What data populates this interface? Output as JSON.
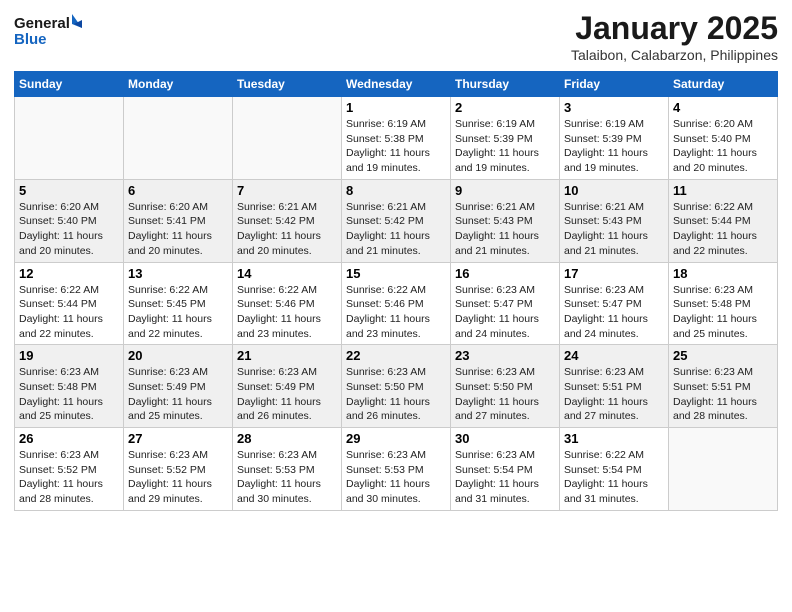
{
  "header": {
    "logo_line1": "General",
    "logo_line2": "Blue",
    "month_title": "January 2025",
    "location": "Talaibon, Calabarzon, Philippines"
  },
  "days_of_week": [
    "Sunday",
    "Monday",
    "Tuesday",
    "Wednesday",
    "Thursday",
    "Friday",
    "Saturday"
  ],
  "weeks": [
    {
      "alt": false,
      "days": [
        {
          "num": "",
          "info": ""
        },
        {
          "num": "",
          "info": ""
        },
        {
          "num": "",
          "info": ""
        },
        {
          "num": "1",
          "info": "Sunrise: 6:19 AM\nSunset: 5:38 PM\nDaylight: 11 hours and 19 minutes."
        },
        {
          "num": "2",
          "info": "Sunrise: 6:19 AM\nSunset: 5:39 PM\nDaylight: 11 hours and 19 minutes."
        },
        {
          "num": "3",
          "info": "Sunrise: 6:19 AM\nSunset: 5:39 PM\nDaylight: 11 hours and 19 minutes."
        },
        {
          "num": "4",
          "info": "Sunrise: 6:20 AM\nSunset: 5:40 PM\nDaylight: 11 hours and 20 minutes."
        }
      ]
    },
    {
      "alt": true,
      "days": [
        {
          "num": "5",
          "info": "Sunrise: 6:20 AM\nSunset: 5:40 PM\nDaylight: 11 hours and 20 minutes."
        },
        {
          "num": "6",
          "info": "Sunrise: 6:20 AM\nSunset: 5:41 PM\nDaylight: 11 hours and 20 minutes."
        },
        {
          "num": "7",
          "info": "Sunrise: 6:21 AM\nSunset: 5:42 PM\nDaylight: 11 hours and 20 minutes."
        },
        {
          "num": "8",
          "info": "Sunrise: 6:21 AM\nSunset: 5:42 PM\nDaylight: 11 hours and 21 minutes."
        },
        {
          "num": "9",
          "info": "Sunrise: 6:21 AM\nSunset: 5:43 PM\nDaylight: 11 hours and 21 minutes."
        },
        {
          "num": "10",
          "info": "Sunrise: 6:21 AM\nSunset: 5:43 PM\nDaylight: 11 hours and 21 minutes."
        },
        {
          "num": "11",
          "info": "Sunrise: 6:22 AM\nSunset: 5:44 PM\nDaylight: 11 hours and 22 minutes."
        }
      ]
    },
    {
      "alt": false,
      "days": [
        {
          "num": "12",
          "info": "Sunrise: 6:22 AM\nSunset: 5:44 PM\nDaylight: 11 hours and 22 minutes."
        },
        {
          "num": "13",
          "info": "Sunrise: 6:22 AM\nSunset: 5:45 PM\nDaylight: 11 hours and 22 minutes."
        },
        {
          "num": "14",
          "info": "Sunrise: 6:22 AM\nSunset: 5:46 PM\nDaylight: 11 hours and 23 minutes."
        },
        {
          "num": "15",
          "info": "Sunrise: 6:22 AM\nSunset: 5:46 PM\nDaylight: 11 hours and 23 minutes."
        },
        {
          "num": "16",
          "info": "Sunrise: 6:23 AM\nSunset: 5:47 PM\nDaylight: 11 hours and 24 minutes."
        },
        {
          "num": "17",
          "info": "Sunrise: 6:23 AM\nSunset: 5:47 PM\nDaylight: 11 hours and 24 minutes."
        },
        {
          "num": "18",
          "info": "Sunrise: 6:23 AM\nSunset: 5:48 PM\nDaylight: 11 hours and 25 minutes."
        }
      ]
    },
    {
      "alt": true,
      "days": [
        {
          "num": "19",
          "info": "Sunrise: 6:23 AM\nSunset: 5:48 PM\nDaylight: 11 hours and 25 minutes."
        },
        {
          "num": "20",
          "info": "Sunrise: 6:23 AM\nSunset: 5:49 PM\nDaylight: 11 hours and 25 minutes."
        },
        {
          "num": "21",
          "info": "Sunrise: 6:23 AM\nSunset: 5:49 PM\nDaylight: 11 hours and 26 minutes."
        },
        {
          "num": "22",
          "info": "Sunrise: 6:23 AM\nSunset: 5:50 PM\nDaylight: 11 hours and 26 minutes."
        },
        {
          "num": "23",
          "info": "Sunrise: 6:23 AM\nSunset: 5:50 PM\nDaylight: 11 hours and 27 minutes."
        },
        {
          "num": "24",
          "info": "Sunrise: 6:23 AM\nSunset: 5:51 PM\nDaylight: 11 hours and 27 minutes."
        },
        {
          "num": "25",
          "info": "Sunrise: 6:23 AM\nSunset: 5:51 PM\nDaylight: 11 hours and 28 minutes."
        }
      ]
    },
    {
      "alt": false,
      "days": [
        {
          "num": "26",
          "info": "Sunrise: 6:23 AM\nSunset: 5:52 PM\nDaylight: 11 hours and 28 minutes."
        },
        {
          "num": "27",
          "info": "Sunrise: 6:23 AM\nSunset: 5:52 PM\nDaylight: 11 hours and 29 minutes."
        },
        {
          "num": "28",
          "info": "Sunrise: 6:23 AM\nSunset: 5:53 PM\nDaylight: 11 hours and 30 minutes."
        },
        {
          "num": "29",
          "info": "Sunrise: 6:23 AM\nSunset: 5:53 PM\nDaylight: 11 hours and 30 minutes."
        },
        {
          "num": "30",
          "info": "Sunrise: 6:23 AM\nSunset: 5:54 PM\nDaylight: 11 hours and 31 minutes."
        },
        {
          "num": "31",
          "info": "Sunrise: 6:22 AM\nSunset: 5:54 PM\nDaylight: 11 hours and 31 minutes."
        },
        {
          "num": "",
          "info": ""
        }
      ]
    }
  ]
}
